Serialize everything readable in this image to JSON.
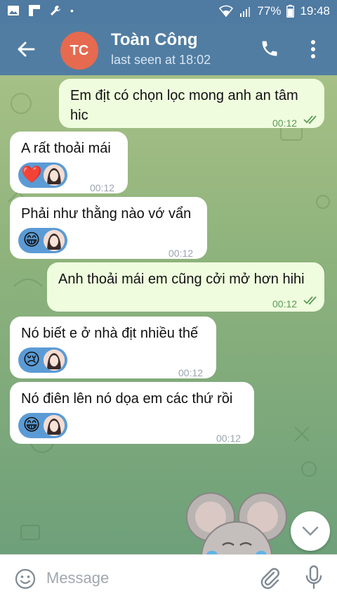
{
  "status_bar": {
    "battery": "77%",
    "time": "19:48",
    "left_icons": [
      "gallery-icon",
      "flipboard-icon",
      "wrench-icon",
      "dot-icon"
    ],
    "right_icons": [
      "wifi-icon",
      "signal-icon",
      "battery-icon"
    ]
  },
  "header": {
    "avatar_initials": "TC",
    "avatar_color": "#e56a4f",
    "name": "Toàn Công",
    "status": "last seen at 18:02"
  },
  "messages": [
    {
      "direction": "out",
      "lines": [
        "Em địt có chọn lọc mong anh an tâm",
        "hic"
      ],
      "time": "00:12",
      "read": true
    },
    {
      "direction": "in",
      "lines": [
        "A rất thoải mái"
      ],
      "reaction": "❤️",
      "time": "00:12"
    },
    {
      "direction": "in",
      "lines": [
        "Phải như thằng nào vớ vẩn"
      ],
      "reaction": "😁",
      "time": "00:12"
    },
    {
      "direction": "out",
      "lines": [
        "Anh thoải mái em cũng cởi mở hơn hihi"
      ],
      "time": "00:12",
      "read": true
    },
    {
      "direction": "in",
      "lines": [
        "Nó biết e ở nhà địt nhiều thế"
      ],
      "reaction": "😢",
      "time": "00:12"
    },
    {
      "direction": "in",
      "lines": [
        "Nó điên lên nó dọa em các thứ rồi"
      ],
      "reaction": "😁",
      "time": "00:12"
    }
  ],
  "input": {
    "placeholder": "Message"
  },
  "colors": {
    "header": "#517da2",
    "outgoing_bubble": "#effdde",
    "incoming_bubble": "#ffffff",
    "reaction_pill": "#5b9bd5",
    "read_ticks": "#5a9a56"
  }
}
